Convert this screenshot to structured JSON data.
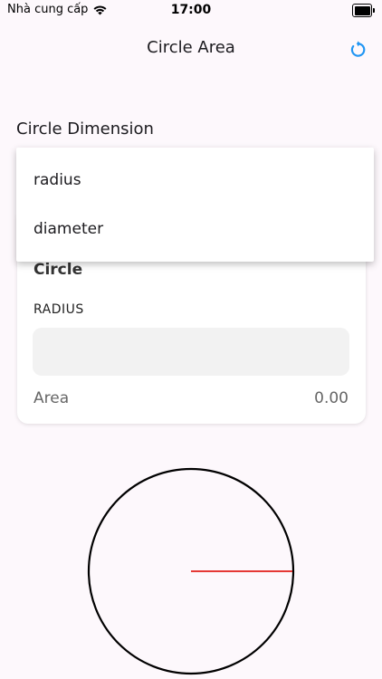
{
  "status_bar": {
    "carrier": "Nhà cung cấp",
    "time": "17:00"
  },
  "app_bar": {
    "title": "Circle Area",
    "reset_icon": "refresh-icon",
    "accent_color": "#2196f3"
  },
  "dimension_section": {
    "label": "Circle Dimension"
  },
  "dropdown": {
    "options": [
      "radius",
      "diameter"
    ]
  },
  "card": {
    "title": "Circle",
    "field_label": "RADIUS",
    "input_value": "",
    "area_label": "Area",
    "area_value": "0.00"
  },
  "drawing": {
    "circle_stroke": "#000000",
    "radius_line_color": "#e53935"
  }
}
